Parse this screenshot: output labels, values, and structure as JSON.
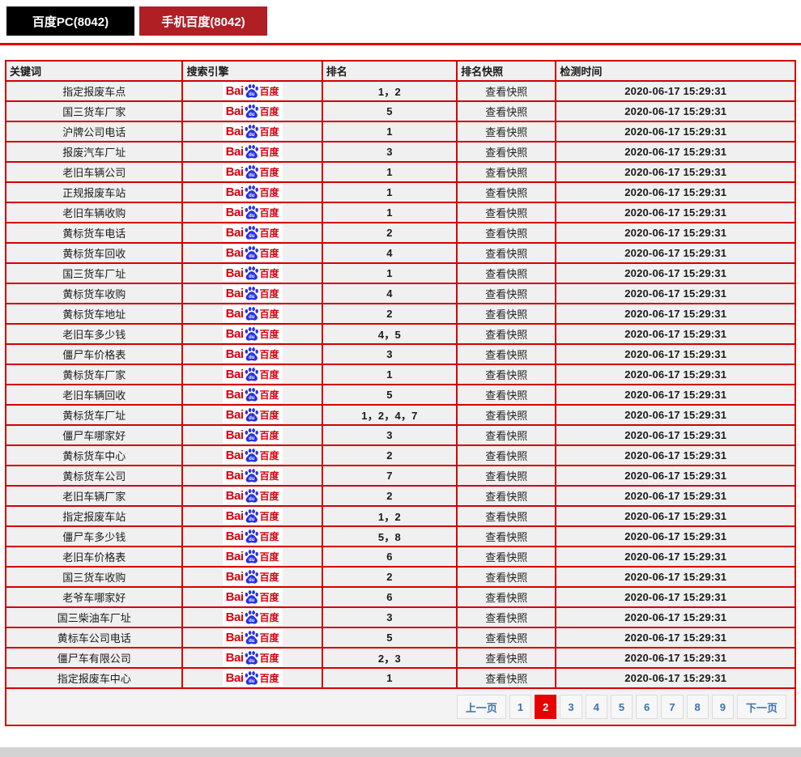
{
  "tabs": [
    {
      "label": "百度PC(8042)"
    },
    {
      "label": "手机百度(8042)"
    }
  ],
  "table": {
    "headers": [
      "关键词",
      "搜索引擎",
      "排名",
      "排名快照",
      "检测时间"
    ],
    "engine_logo": {
      "bai": "Bai",
      "du": "du",
      "baidu_cn": "百度"
    },
    "rows": [
      {
        "keyword": "指定报废车点",
        "rank": "1，2",
        "snapshot": "查看快照",
        "time": "2020-06-17 15:29:31"
      },
      {
        "keyword": "国三货车厂家",
        "rank": "5",
        "snapshot": "查看快照",
        "time": "2020-06-17 15:29:31"
      },
      {
        "keyword": "沪牌公司电话",
        "rank": "1",
        "snapshot": "查看快照",
        "time": "2020-06-17 15:29:31"
      },
      {
        "keyword": "报废汽车厂址",
        "rank": "3",
        "snapshot": "查看快照",
        "time": "2020-06-17 15:29:31"
      },
      {
        "keyword": "老旧车辆公司",
        "rank": "1",
        "snapshot": "查看快照",
        "time": "2020-06-17 15:29:31"
      },
      {
        "keyword": "正规报废车站",
        "rank": "1",
        "snapshot": "查看快照",
        "time": "2020-06-17 15:29:31"
      },
      {
        "keyword": "老旧车辆收购",
        "rank": "1",
        "snapshot": "查看快照",
        "time": "2020-06-17 15:29:31"
      },
      {
        "keyword": "黄标货车电话",
        "rank": "2",
        "snapshot": "查看快照",
        "time": "2020-06-17 15:29:31"
      },
      {
        "keyword": "黄标货车回收",
        "rank": "4",
        "snapshot": "查看快照",
        "time": "2020-06-17 15:29:31"
      },
      {
        "keyword": "国三货车厂址",
        "rank": "1",
        "snapshot": "查看快照",
        "time": "2020-06-17 15:29:31"
      },
      {
        "keyword": "黄标货车收购",
        "rank": "4",
        "snapshot": "查看快照",
        "time": "2020-06-17 15:29:31"
      },
      {
        "keyword": "黄标货车地址",
        "rank": "2",
        "snapshot": "查看快照",
        "time": "2020-06-17 15:29:31"
      },
      {
        "keyword": "老旧车多少钱",
        "rank": "4，5",
        "snapshot": "查看快照",
        "time": "2020-06-17 15:29:31"
      },
      {
        "keyword": "僵尸车价格表",
        "rank": "3",
        "snapshot": "查看快照",
        "time": "2020-06-17 15:29:31"
      },
      {
        "keyword": "黄标货车厂家",
        "rank": "1",
        "snapshot": "查看快照",
        "time": "2020-06-17 15:29:31"
      },
      {
        "keyword": "老旧车辆回收",
        "rank": "5",
        "snapshot": "查看快照",
        "time": "2020-06-17 15:29:31"
      },
      {
        "keyword": "黄标货车厂址",
        "rank": "1，2，4，7",
        "snapshot": "查看快照",
        "time": "2020-06-17 15:29:31"
      },
      {
        "keyword": "僵尸车哪家好",
        "rank": "3",
        "snapshot": "查看快照",
        "time": "2020-06-17 15:29:31"
      },
      {
        "keyword": "黄标货车中心",
        "rank": "2",
        "snapshot": "查看快照",
        "time": "2020-06-17 15:29:31"
      },
      {
        "keyword": "黄标货车公司",
        "rank": "7",
        "snapshot": "查看快照",
        "time": "2020-06-17 15:29:31"
      },
      {
        "keyword": "老旧车辆厂家",
        "rank": "2",
        "snapshot": "查看快照",
        "time": "2020-06-17 15:29:31"
      },
      {
        "keyword": "指定报废车站",
        "rank": "1，2",
        "snapshot": "查看快照",
        "time": "2020-06-17 15:29:31"
      },
      {
        "keyword": "僵尸车多少钱",
        "rank": "5，8",
        "snapshot": "查看快照",
        "time": "2020-06-17 15:29:31"
      },
      {
        "keyword": "老旧车价格表",
        "rank": "6",
        "snapshot": "查看快照",
        "time": "2020-06-17 15:29:31"
      },
      {
        "keyword": "国三货车收购",
        "rank": "2",
        "snapshot": "查看快照",
        "time": "2020-06-17 15:29:31"
      },
      {
        "keyword": "老爷车哪家好",
        "rank": "6",
        "snapshot": "查看快照",
        "time": "2020-06-17 15:29:31"
      },
      {
        "keyword": "国三柴油车厂址",
        "rank": "3",
        "snapshot": "查看快照",
        "time": "2020-06-17 15:29:31"
      },
      {
        "keyword": "黄标车公司电话",
        "rank": "5",
        "snapshot": "查看快照",
        "time": "2020-06-17 15:29:31"
      },
      {
        "keyword": "僵尸车有限公司",
        "rank": "2，3",
        "snapshot": "查看快照",
        "time": "2020-06-17 15:29:31"
      },
      {
        "keyword": "指定报废车中心",
        "rank": "1",
        "snapshot": "查看快照",
        "time": "2020-06-17 15:29:31"
      }
    ]
  },
  "pagination": {
    "prev": "上一页",
    "pages": [
      "1",
      "2",
      "3",
      "4",
      "5",
      "6",
      "7",
      "8",
      "9"
    ],
    "active": "2",
    "next": "下一页"
  },
  "colors": {
    "tab_inactive_bg": "#000000",
    "tab_active_bg": "#b01f24",
    "accent_red": "#e60000",
    "table_border_red": "#d40000",
    "baidu_red": "#d7000f",
    "baidu_blue": "#2932e1",
    "link_blue": "#3b73af"
  }
}
